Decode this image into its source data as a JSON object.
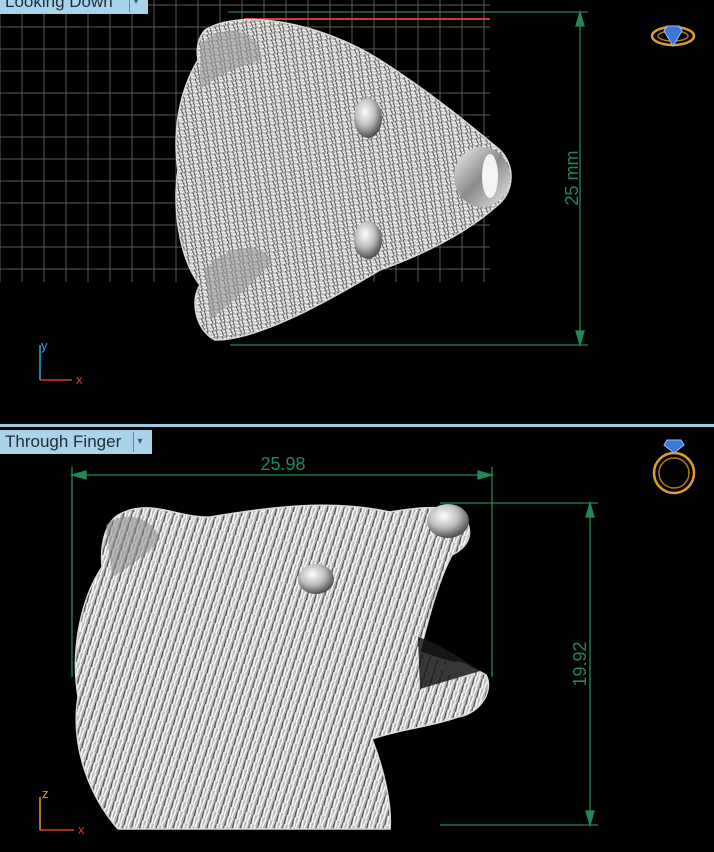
{
  "viewports": {
    "top": {
      "name": "Looking Down",
      "dimension": "25 mm"
    },
    "bottom": {
      "name": "Through Finger",
      "width_dimension": "25.98",
      "height_dimension": "19.92"
    }
  },
  "axes": {
    "top": {
      "horizontal": "x",
      "vertical": "y"
    },
    "bottom": {
      "horizontal": "x",
      "vertical": "z"
    }
  },
  "colors": {
    "dimension": "#1f8a57",
    "grid": "#5a5a5a",
    "tab": "#a9d3ea",
    "x_axis": "#d33b2c",
    "y_axis": "#2aa8e0",
    "z_axis": "#e0a020",
    "ring_icon": "#e0a020",
    "gem": "#3a78d8"
  },
  "icons": {
    "top": "ring-top-view-icon",
    "bottom": "ring-side-view-icon"
  }
}
